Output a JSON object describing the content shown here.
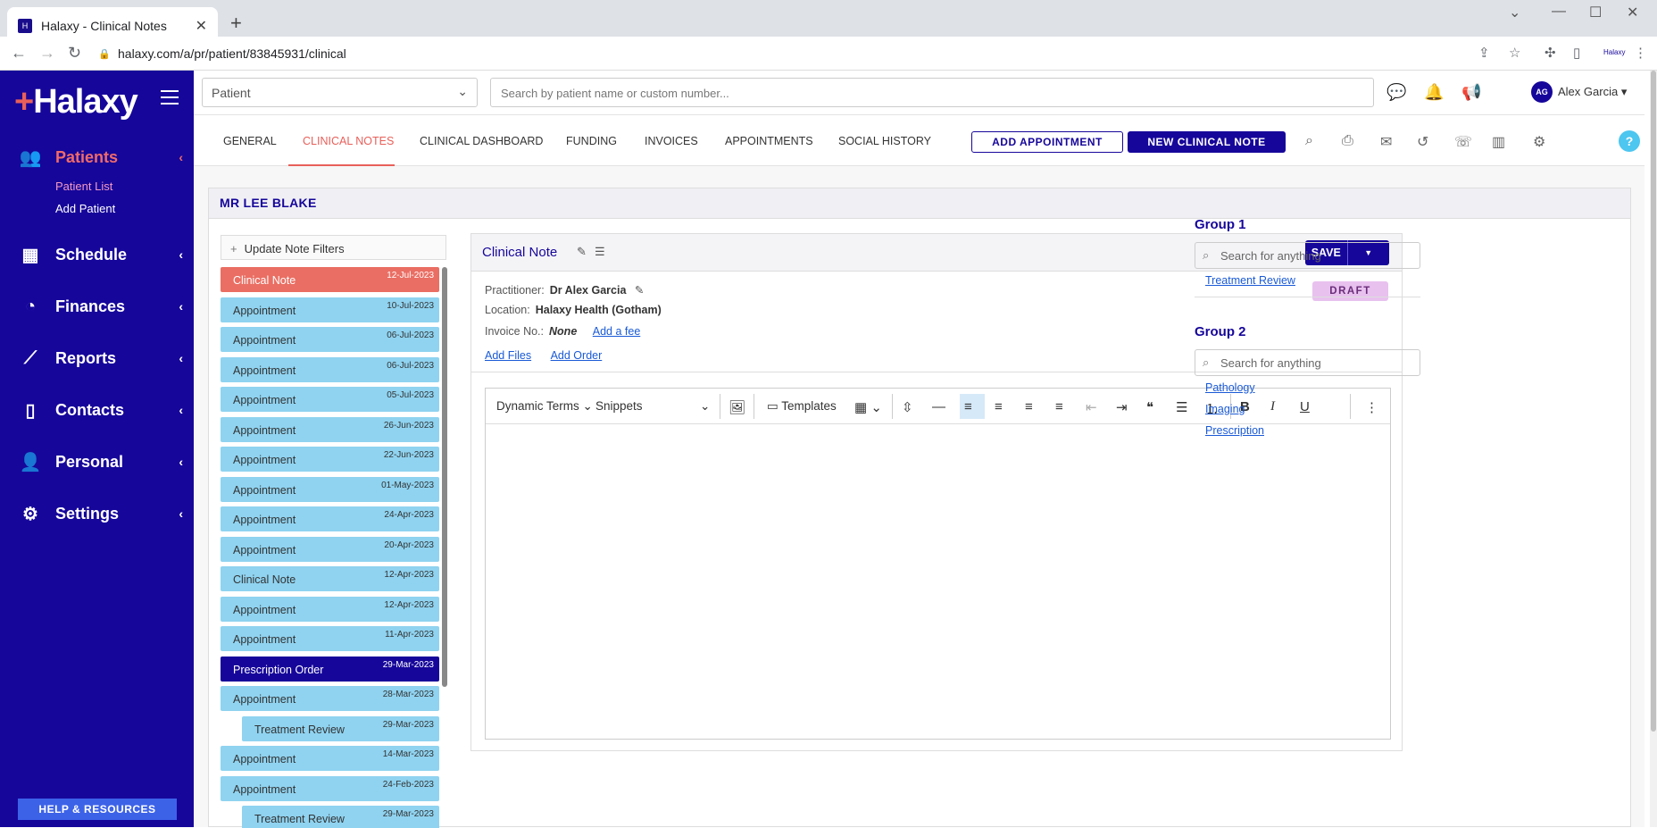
{
  "browser": {
    "tab_title": "Halaxy - Clinical Notes",
    "url": "halaxy.com/a/pr/patient/83845931/clinical"
  },
  "sidebar": {
    "logo": "Halaxy",
    "items": [
      {
        "label": "Patients",
        "icon": "patients-icon"
      },
      {
        "label": "Schedule",
        "icon": "calendar-icon"
      },
      {
        "label": "Finances",
        "icon": "pie-chart-icon"
      },
      {
        "label": "Reports",
        "icon": "line-chart-icon"
      },
      {
        "label": "Contacts",
        "icon": "book-icon"
      },
      {
        "label": "Personal",
        "icon": "person-icon"
      },
      {
        "label": "Settings",
        "icon": "gear-icon"
      }
    ],
    "patients_sub": [
      "Patient List",
      "Add Patient"
    ],
    "help": "HELP & RESOURCES"
  },
  "topbar": {
    "selector_value": "Patient",
    "search_placeholder": "Search by patient name or custom number...",
    "user": "Alex Garcia",
    "user_initials": "AG"
  },
  "tabs": [
    "GENERAL",
    "CLINICAL NOTES",
    "CLINICAL DASHBOARD",
    "FUNDING",
    "INVOICES",
    "APPOINTMENTS",
    "SOCIAL HISTORY"
  ],
  "actions": {
    "add_appointment": "ADD APPOINTMENT",
    "new_note": "NEW CLINICAL NOTE"
  },
  "patient_name": "MR LEE BLAKE",
  "filter_label": "Update Note Filters",
  "notes": [
    {
      "label": "Clinical Note",
      "date": "12-Jul-2023",
      "style": "red"
    },
    {
      "label": "Appointment",
      "date": "10-Jul-2023",
      "style": "blue"
    },
    {
      "label": "Appointment",
      "date": "06-Jul-2023",
      "style": "blue"
    },
    {
      "label": "Appointment",
      "date": "06-Jul-2023",
      "style": "blue"
    },
    {
      "label": "Appointment",
      "date": "05-Jul-2023",
      "style": "blue"
    },
    {
      "label": "Appointment",
      "date": "26-Jun-2023",
      "style": "blue"
    },
    {
      "label": "Appointment",
      "date": "22-Jun-2023",
      "style": "blue"
    },
    {
      "label": "Appointment",
      "date": "01-May-2023",
      "style": "blue"
    },
    {
      "label": "Appointment",
      "date": "24-Apr-2023",
      "style": "blue"
    },
    {
      "label": "Appointment",
      "date": "20-Apr-2023",
      "style": "blue"
    },
    {
      "label": "Clinical Note",
      "date": "12-Apr-2023",
      "style": "blue"
    },
    {
      "label": "Appointment",
      "date": "12-Apr-2023",
      "style": "blue"
    },
    {
      "label": "Appointment",
      "date": "11-Apr-2023",
      "style": "blue"
    },
    {
      "label": "Prescription Order",
      "date": "29-Mar-2023",
      "style": "navy"
    },
    {
      "label": "Appointment",
      "date": "28-Mar-2023",
      "style": "blue"
    },
    {
      "label": "Treatment Review",
      "date": "29-Mar-2023",
      "style": "indent"
    },
    {
      "label": "Appointment",
      "date": "14-Mar-2023",
      "style": "blue"
    },
    {
      "label": "Appointment",
      "date": "24-Feb-2023",
      "style": "blue"
    },
    {
      "label": "Treatment Review",
      "date": "29-Mar-2023",
      "style": "indent"
    }
  ],
  "note_card": {
    "title": "Clinical Note",
    "save": "SAVE",
    "status": "DRAFT",
    "practitioner_label": "Practitioner:",
    "practitioner": "Dr Alex Garcia",
    "location_label": "Location:",
    "location": "Halaxy Health (Gotham)",
    "invoice_label": "Invoice No.:",
    "invoice": "None",
    "add_fee": "Add a fee",
    "add_files": "Add Files",
    "add_order": "Add Order"
  },
  "editor": {
    "dynamic_terms": "Dynamic Terms",
    "snippets": "Snippets",
    "templates": "Templates"
  },
  "groups": [
    {
      "title": "Group 1",
      "placeholder": "Search for anything",
      "links": [
        "Treatment Review"
      ]
    },
    {
      "title": "Group 2",
      "placeholder": "Search for anything",
      "links": [
        "Pathology",
        "Imaging",
        "Prescription"
      ]
    }
  ],
  "colors": {
    "brand": "#16069a",
    "accent": "#e8605a",
    "note_blue": "#8fd3f0",
    "draft": "#e8c1ef"
  }
}
